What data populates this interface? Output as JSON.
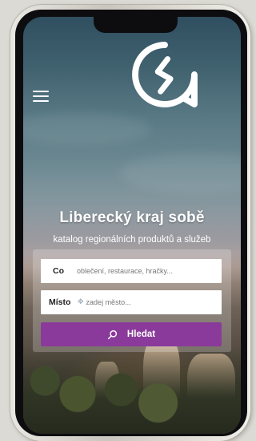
{
  "hero": {
    "title": "Liberecký kraj sobě",
    "subtitle": "katalog regionálních produktů a služeb"
  },
  "search_form": {
    "what_label": "Co",
    "what_placeholder": "oblečení, restaurace, hračky...",
    "where_label": "Místo",
    "where_placeholder": "zadej město...",
    "submit_label": "Hledat"
  },
  "icons": {
    "menu": "hamburger-menu-icon",
    "logo": "brand-logo-icon",
    "location": "location-pin-icon",
    "search": "search-icon"
  },
  "colors": {
    "accent": "#8a3a9a",
    "text_light": "#ffffff"
  }
}
